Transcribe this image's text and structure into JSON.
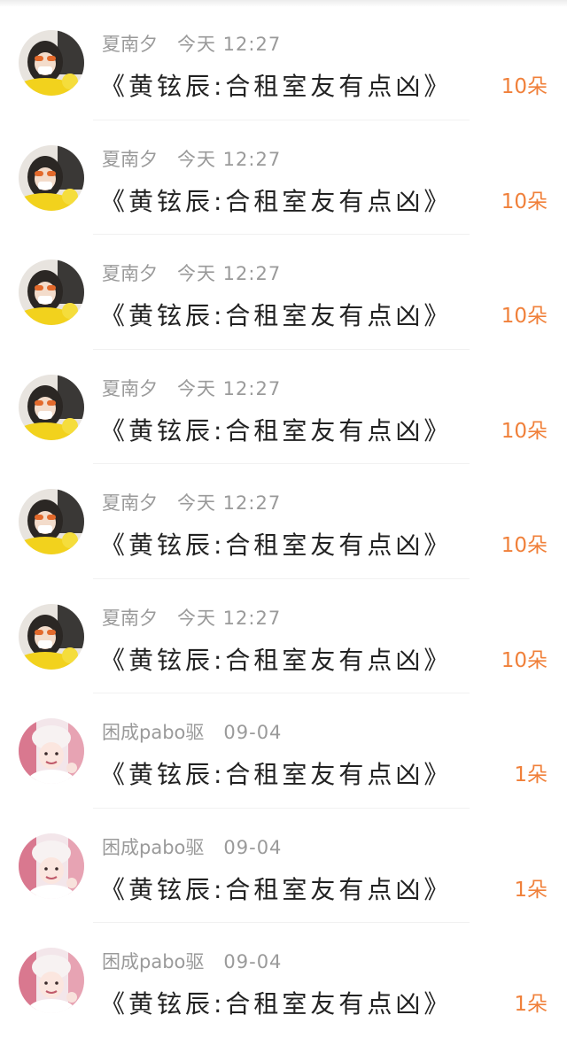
{
  "gifts": [
    {
      "name": "夏南夕",
      "time": "今天 12:27",
      "message": "《黄铉辰:合租室友有点凶》",
      "count": "10朵",
      "avatar": "sunglasses-avatar"
    },
    {
      "name": "夏南夕",
      "time": "今天 12:27",
      "message": "《黄铉辰:合租室友有点凶》",
      "count": "10朵",
      "avatar": "sunglasses-avatar"
    },
    {
      "name": "夏南夕",
      "time": "今天 12:27",
      "message": "《黄铉辰:合租室友有点凶》",
      "count": "10朵",
      "avatar": "sunglasses-avatar"
    },
    {
      "name": "夏南夕",
      "time": "今天 12:27",
      "message": "《黄铉辰:合租室友有点凶》",
      "count": "10朵",
      "avatar": "sunglasses-avatar"
    },
    {
      "name": "夏南夕",
      "time": "今天 12:27",
      "message": "《黄铉辰:合租室友有点凶》",
      "count": "10朵",
      "avatar": "sunglasses-avatar"
    },
    {
      "name": "夏南夕",
      "time": "今天 12:27",
      "message": "《黄铉辰:合租室友有点凶》",
      "count": "10朵",
      "avatar": "sunglasses-avatar"
    },
    {
      "name": "困成pabo驱",
      "time": "09-04",
      "message": "《黄铉辰:合租室友有点凶》",
      "count": "1朵",
      "avatar": "pink-hat-avatar"
    },
    {
      "name": "困成pabo驱",
      "time": "09-04",
      "message": "《黄铉辰:合租室友有点凶》",
      "count": "1朵",
      "avatar": "pink-hat-avatar"
    },
    {
      "name": "困成pabo驱",
      "time": "09-04",
      "message": "《黄铉辰:合租室友有点凶》",
      "count": "1朵",
      "avatar": "pink-hat-avatar"
    }
  ],
  "colors": {
    "count": "#f0803a",
    "meta": "#9a9a9a",
    "message": "#222222"
  }
}
